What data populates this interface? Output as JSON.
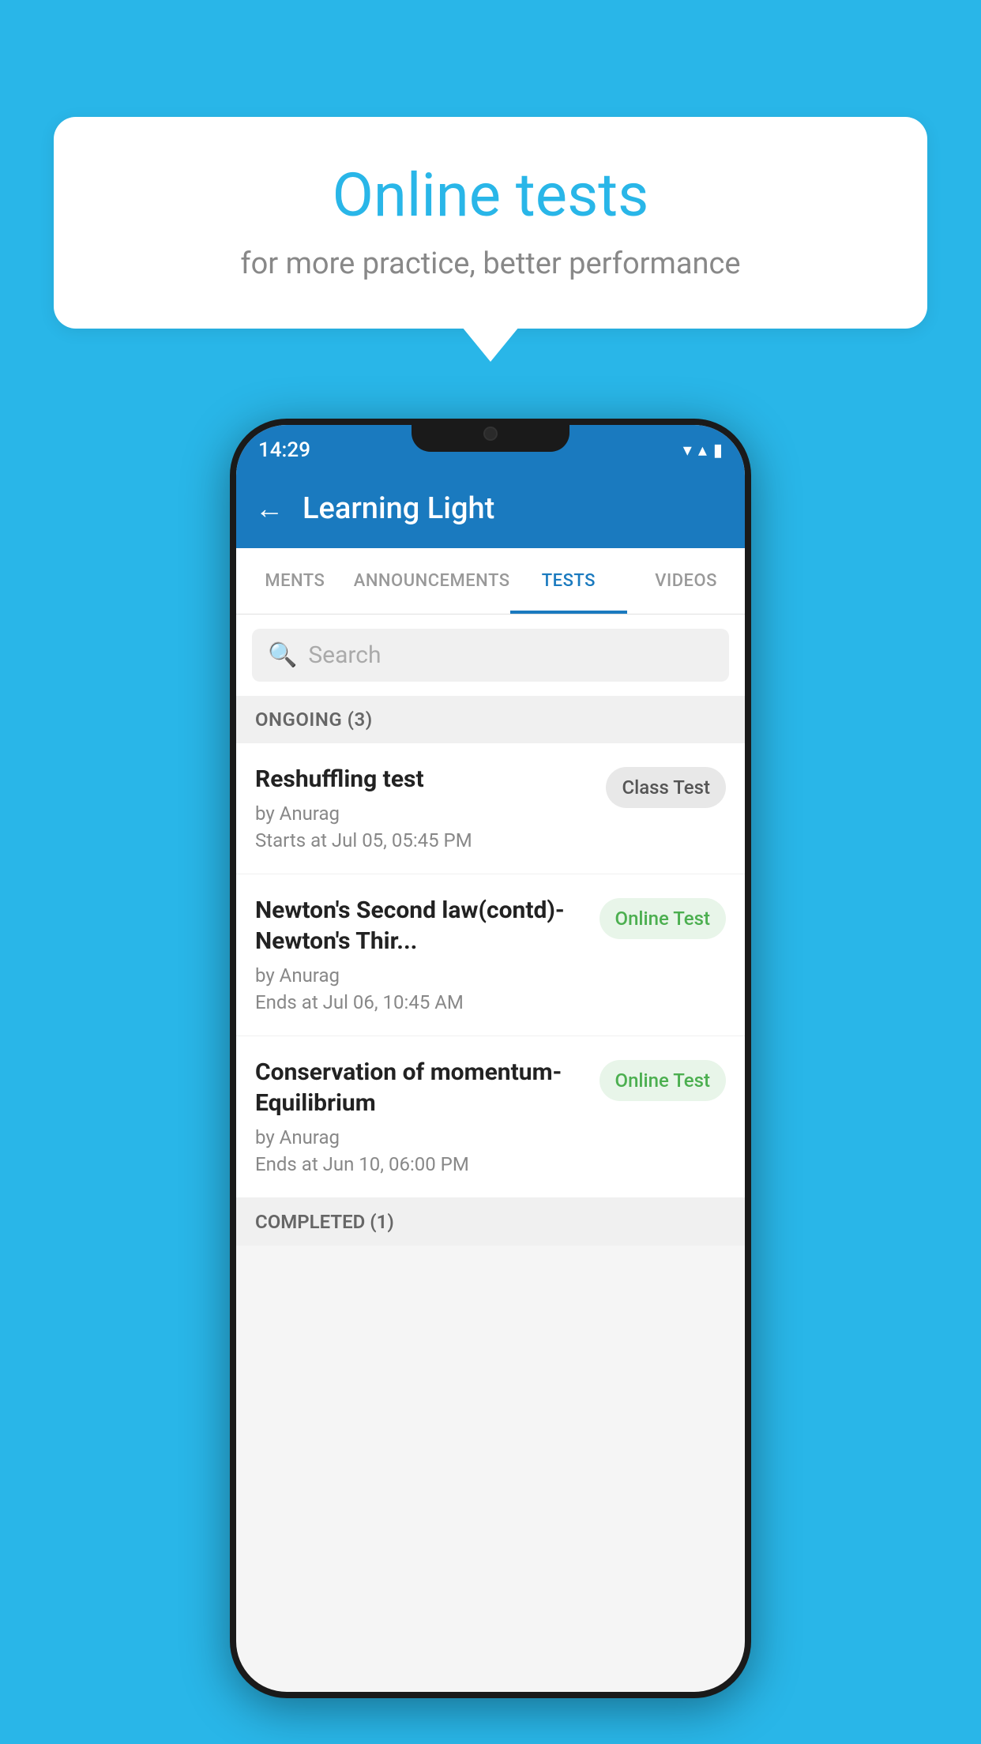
{
  "background": {
    "color": "#29b6e8"
  },
  "speech_bubble": {
    "title": "Online tests",
    "subtitle": "for more practice, better performance"
  },
  "status_bar": {
    "time": "14:29",
    "wifi": "▼",
    "signal": "▲",
    "battery": "▮"
  },
  "app_header": {
    "title": "Learning Light",
    "back_label": "←"
  },
  "tabs": [
    {
      "id": "ments",
      "label": "MENTS",
      "active": false
    },
    {
      "id": "announcements",
      "label": "ANNOUNCEMENTS",
      "active": false
    },
    {
      "id": "tests",
      "label": "TESTS",
      "active": true
    },
    {
      "id": "videos",
      "label": "VIDEOS",
      "active": false
    }
  ],
  "search": {
    "placeholder": "Search"
  },
  "ongoing": {
    "label": "ONGOING (3)",
    "items": [
      {
        "name": "Reshuffling test",
        "author": "by Anurag",
        "date": "Starts at  Jul 05, 05:45 PM",
        "badge": "Class Test",
        "badge_type": "class"
      },
      {
        "name": "Newton's Second law(contd)-Newton's Thir...",
        "author": "by Anurag",
        "date": "Ends at  Jul 06, 10:45 AM",
        "badge": "Online Test",
        "badge_type": "online"
      },
      {
        "name": "Conservation of momentum-Equilibrium",
        "author": "by Anurag",
        "date": "Ends at  Jun 10, 06:00 PM",
        "badge": "Online Test",
        "badge_type": "online"
      }
    ]
  },
  "completed": {
    "label": "COMPLETED (1)"
  }
}
